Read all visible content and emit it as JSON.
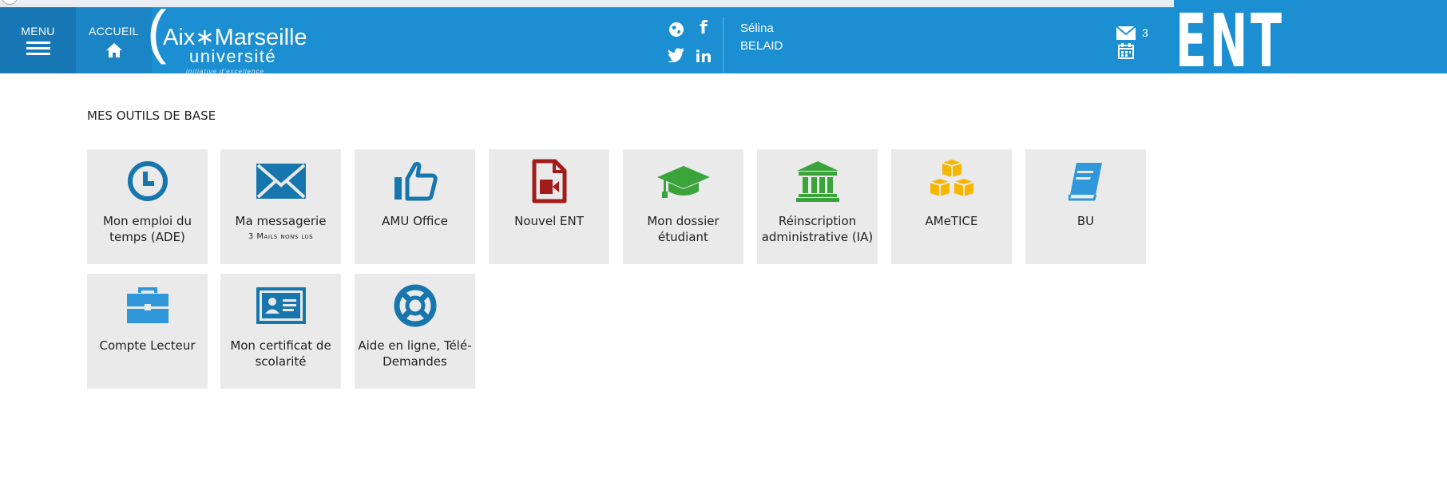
{
  "header": {
    "menu_label": "MENU",
    "home_label": "ACCUEIL",
    "logo": {
      "line1": "Aix∗Marseille",
      "line2": "université",
      "tagline": "initiative d'excellence"
    },
    "social_icons": [
      "globe-icon",
      "facebook-icon",
      "twitter-icon",
      "linkedin-icon"
    ],
    "user": {
      "first_name": "Sélina",
      "last_name": "BELAID"
    },
    "mail_count": "3",
    "ent_label": "ENT",
    "colors": {
      "bar": "#1b8fd2",
      "menu_bg": "#1677b4"
    }
  },
  "main": {
    "section_title": "MES OUTILS DE BASE",
    "tiles": [
      {
        "label": "Mon emploi du temps (ADE)",
        "icon": "clock-icon",
        "color": "#1776ae"
      },
      {
        "label": "Ma messagerie",
        "sublabel": "3 Mails nons lus",
        "icon": "envelope-icon",
        "color": "#1776ae"
      },
      {
        "label": "AMU Office",
        "icon": "thumbs-up-icon",
        "color": "#1776ae"
      },
      {
        "label": "Nouvel ENT",
        "icon": "video-file-icon",
        "color": "#a31c1c"
      },
      {
        "label": "Mon dossier étudiant",
        "icon": "graduation-cap-icon",
        "color": "#3aa43a"
      },
      {
        "label": "Réinscription administrative (IA)",
        "icon": "institution-icon",
        "color": "#3aa43a"
      },
      {
        "label": "AMeTICE",
        "icon": "cubes-icon",
        "color": "#f7b500"
      },
      {
        "label": "BU",
        "icon": "book-icon",
        "color": "#2f97da"
      },
      {
        "label": "Compte Lecteur",
        "icon": "briefcase-icon",
        "color": "#2f97da"
      },
      {
        "label": "Mon certificat de scolarité",
        "icon": "id-card-icon",
        "color": "#1776ae"
      },
      {
        "label": "Aide en ligne, Télé-Demandes",
        "icon": "life-ring-icon",
        "color": "#1776ae"
      }
    ]
  }
}
